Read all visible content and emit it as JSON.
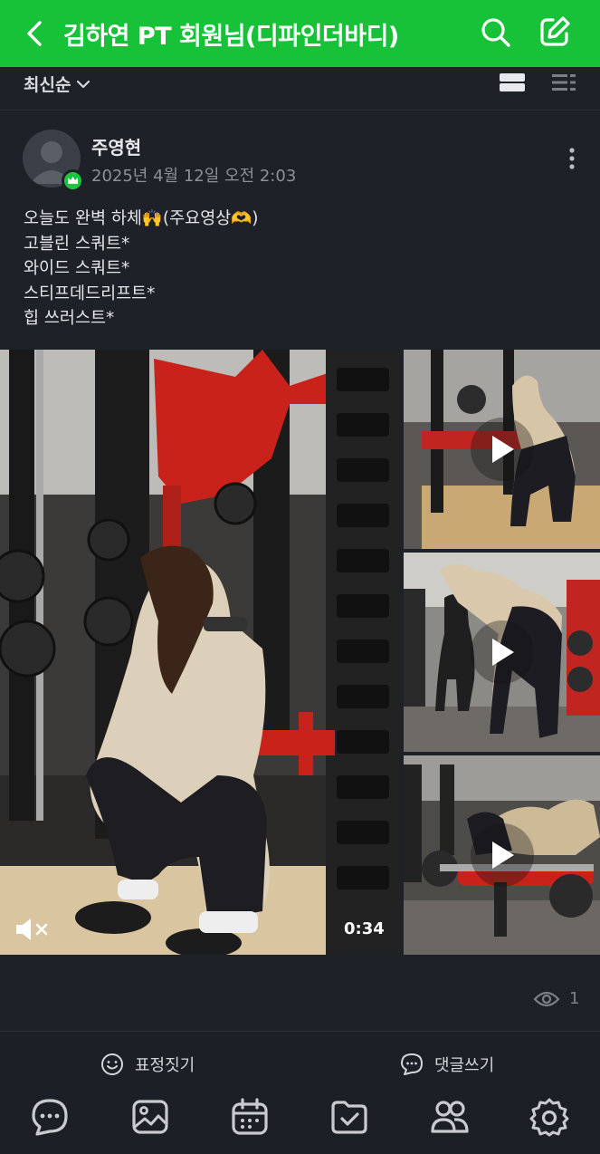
{
  "header": {
    "title": "김하연 PT 회원님(디파인더바디)"
  },
  "filter": {
    "sort_label": "최신순"
  },
  "post": {
    "author": "주영현",
    "date": "2025년 4월 12일 오전 2:03",
    "lines": [
      "오늘도 완벽 하체🙌(주요영상🫶)",
      "고블린 스쿼트*",
      "와이드 스쿼트*",
      "스티프데드리프트*",
      "힙 쓰러스트*"
    ],
    "video": {
      "duration": "0:34"
    },
    "views": "1"
  },
  "actions": {
    "emotion_label": "표정짓기",
    "comment_label": "댓글쓰기"
  },
  "colors": {
    "header_green": "#17c238",
    "badge_green": "#1ec43d",
    "background": "#1a1d22"
  },
  "icons": {
    "header": [
      "back-icon",
      "search-icon",
      "edit-icon"
    ],
    "nav": [
      "chat-icon",
      "photo-icon",
      "calendar-icon",
      "checklist-folder-icon",
      "members-icon",
      "settings-icon"
    ]
  }
}
